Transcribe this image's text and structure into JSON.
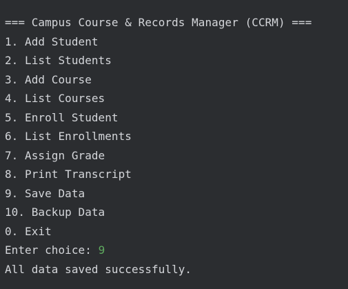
{
  "console": {
    "header": "=== Campus Course & Records Manager (CCRM) ===",
    "menu": [
      "1. Add Student",
      "2. List Students",
      "3. Add Course",
      "4. List Courses",
      "5. Enroll Student",
      "6. List Enrollments",
      "7. Assign Grade",
      "8. Print Transcript",
      "9. Save Data",
      "10. Backup Data",
      "0. Exit"
    ],
    "prompt": "Enter choice: ",
    "input_value": "9",
    "output": "All data saved successfully.",
    "colors": {
      "background": "#2b2d30",
      "text": "#d4d6da",
      "user_input": "#5faa5f"
    }
  }
}
